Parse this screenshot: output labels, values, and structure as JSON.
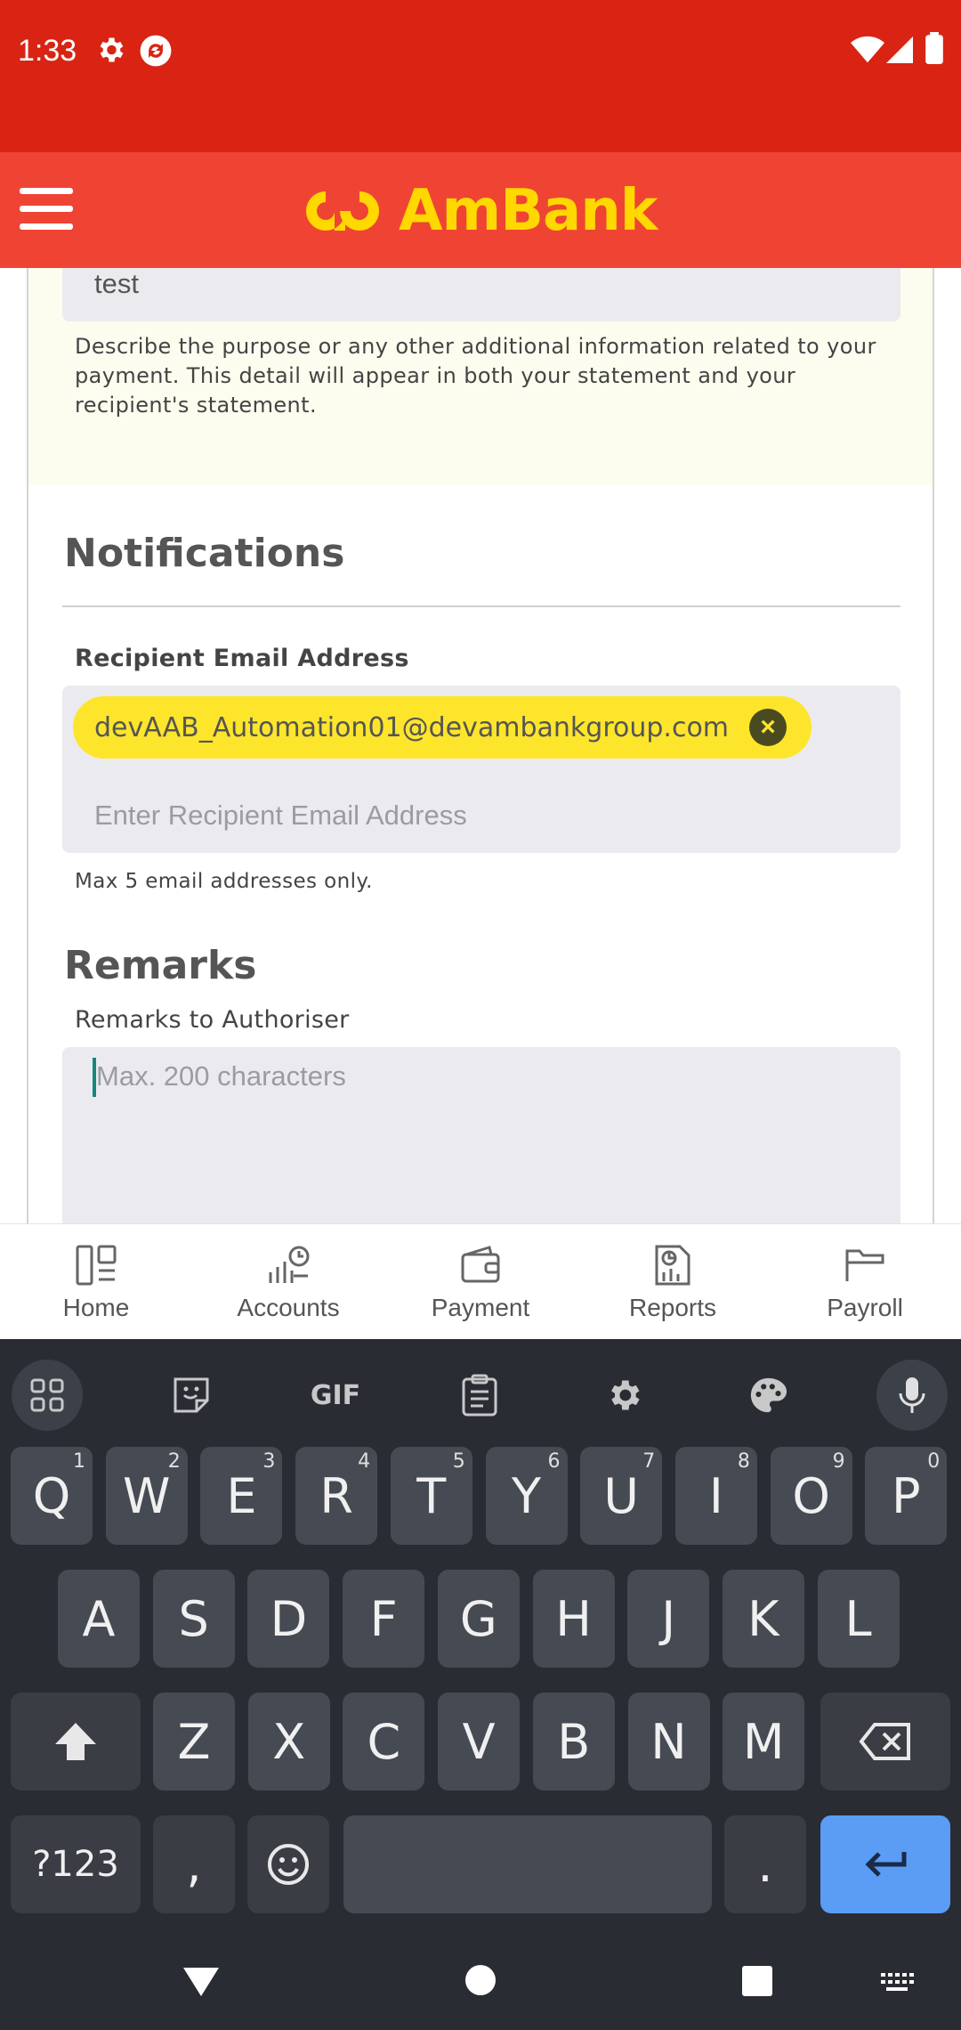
{
  "status_bar": {
    "time": "1:33",
    "icons": [
      "gear-icon",
      "sync-icon",
      "wifi-icon",
      "signal-icon",
      "battery-icon"
    ]
  },
  "header": {
    "brand": "AmBank",
    "menu_icon": "hamburger-menu-icon",
    "colors": {
      "status_bar": "#d92413",
      "header": "#ef4434",
      "brand": "#ffd800"
    }
  },
  "payment_details": {
    "reference_value": "test",
    "helper_text": "Describe the purpose or any other additional information related to your payment. This detail will appear in both your statement and your recipient's statement."
  },
  "notifications": {
    "title": "Notifications",
    "email_label": "Recipient Email Address",
    "email_chip": "devAAB_Automation01@devambankgroup.com",
    "email_placeholder": "Enter Recipient Email Address",
    "email_hint": "Max 5 email addresses only."
  },
  "remarks": {
    "title": "Remarks",
    "label": "Remarks to Authoriser",
    "placeholder": "Max. 200 characters"
  },
  "bottom_nav": {
    "items": [
      {
        "label": "Home",
        "icon": "home-icon"
      },
      {
        "label": "Accounts",
        "icon": "accounts-icon"
      },
      {
        "label": "Payment",
        "icon": "wallet-icon"
      },
      {
        "label": "Reports",
        "icon": "reports-icon"
      },
      {
        "label": "Payroll",
        "icon": "folder-icon"
      }
    ]
  },
  "keyboard": {
    "toolbar": [
      "apps-grid-icon",
      "sticker-icon",
      "gif-icon",
      "clipboard-icon",
      "settings-icon",
      "palette-icon",
      "mic-icon"
    ],
    "gif_label": "GIF",
    "row1": [
      {
        "key": "Q",
        "sup": "1"
      },
      {
        "key": "W",
        "sup": "2"
      },
      {
        "key": "E",
        "sup": "3"
      },
      {
        "key": "R",
        "sup": "4"
      },
      {
        "key": "T",
        "sup": "5"
      },
      {
        "key": "Y",
        "sup": "6"
      },
      {
        "key": "U",
        "sup": "7"
      },
      {
        "key": "I",
        "sup": "8"
      },
      {
        "key": "O",
        "sup": "9"
      },
      {
        "key": "P",
        "sup": "0"
      }
    ],
    "row2": [
      "A",
      "S",
      "D",
      "F",
      "G",
      "H",
      "J",
      "K",
      "L"
    ],
    "row3": [
      "Z",
      "X",
      "C",
      "V",
      "B",
      "N",
      "M"
    ],
    "symbols_label": "?123",
    "comma": ",",
    "period": "."
  }
}
